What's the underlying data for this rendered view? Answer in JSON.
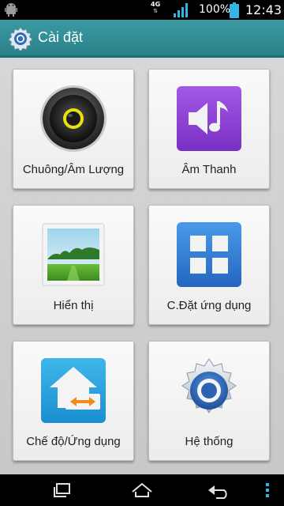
{
  "status": {
    "network": "4G",
    "battery_percent": "100%",
    "time": "12:43"
  },
  "header": {
    "title": "Cài đặt",
    "icon": "settings-gear-icon"
  },
  "tiles": [
    {
      "label": "Chuông/Âm Lượng",
      "icon": "speaker-icon"
    },
    {
      "label": "Âm Thanh",
      "icon": "sound-note-icon"
    },
    {
      "label": "Hiển thị",
      "icon": "display-picture-icon"
    },
    {
      "label": "C.Đặt ứng dụng",
      "icon": "apps-grid-icon"
    },
    {
      "label": "Chế độ/Ứng dụng",
      "icon": "home-switch-icon"
    },
    {
      "label": "Hệ thống",
      "icon": "system-gear-icon"
    }
  ],
  "nav": {
    "buttons": [
      "recent-apps-icon",
      "home-icon",
      "back-icon",
      "menu-icon"
    ]
  },
  "colors": {
    "action_bar": "#2f8c94",
    "accent_purple": "#8a3fd0",
    "accent_blue": "#2f7fd8"
  }
}
